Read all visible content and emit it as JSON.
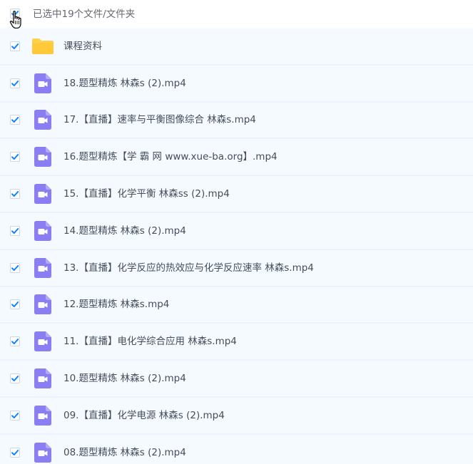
{
  "header": {
    "selection_text": "已选中19个文件/文件夹",
    "select_all_checked": true
  },
  "icons": {
    "folder": "folder-icon",
    "video": "video-file-icon",
    "checkbox": "checkmark-icon",
    "cursor": "hand-pointer-icon"
  },
  "colors": {
    "check": "#0b84ff",
    "video_icon": "#8b7df2",
    "folder": "#ffd04c",
    "row_bg": "#f4faff"
  },
  "files": [
    {
      "name": "课程资料",
      "type": "folder",
      "checked": true
    },
    {
      "name": "18.题型精炼 林森s (2).mp4",
      "type": "video",
      "checked": true
    },
    {
      "name": "17.【直播】速率与平衡图像综合 林森s.mp4",
      "type": "video",
      "checked": true
    },
    {
      "name": "16.题型精炼【学 霸 网 www.xue-ba.org】.mp4",
      "type": "video",
      "checked": true
    },
    {
      "name": "15.【直播】化学平衡 林森ss (2).mp4",
      "type": "video",
      "checked": true
    },
    {
      "name": "14.题型精炼 林森s (2).mp4",
      "type": "video",
      "checked": true
    },
    {
      "name": "13.【直播】化学反应的热效应与化学反应速率 林森s.mp4",
      "type": "video",
      "checked": true
    },
    {
      "name": "12.题型精炼 林森s.mp4",
      "type": "video",
      "checked": true
    },
    {
      "name": "11.【直播】电化学综合应用 林森s.mp4",
      "type": "video",
      "checked": true
    },
    {
      "name": "10.题型精炼 林森s (2).mp4",
      "type": "video",
      "checked": true
    },
    {
      "name": "09.【直播】化学电源 林森s (2).mp4",
      "type": "video",
      "checked": true
    },
    {
      "name": "08.题型精炼 林森s (2).mp4",
      "type": "video",
      "checked": true
    }
  ]
}
